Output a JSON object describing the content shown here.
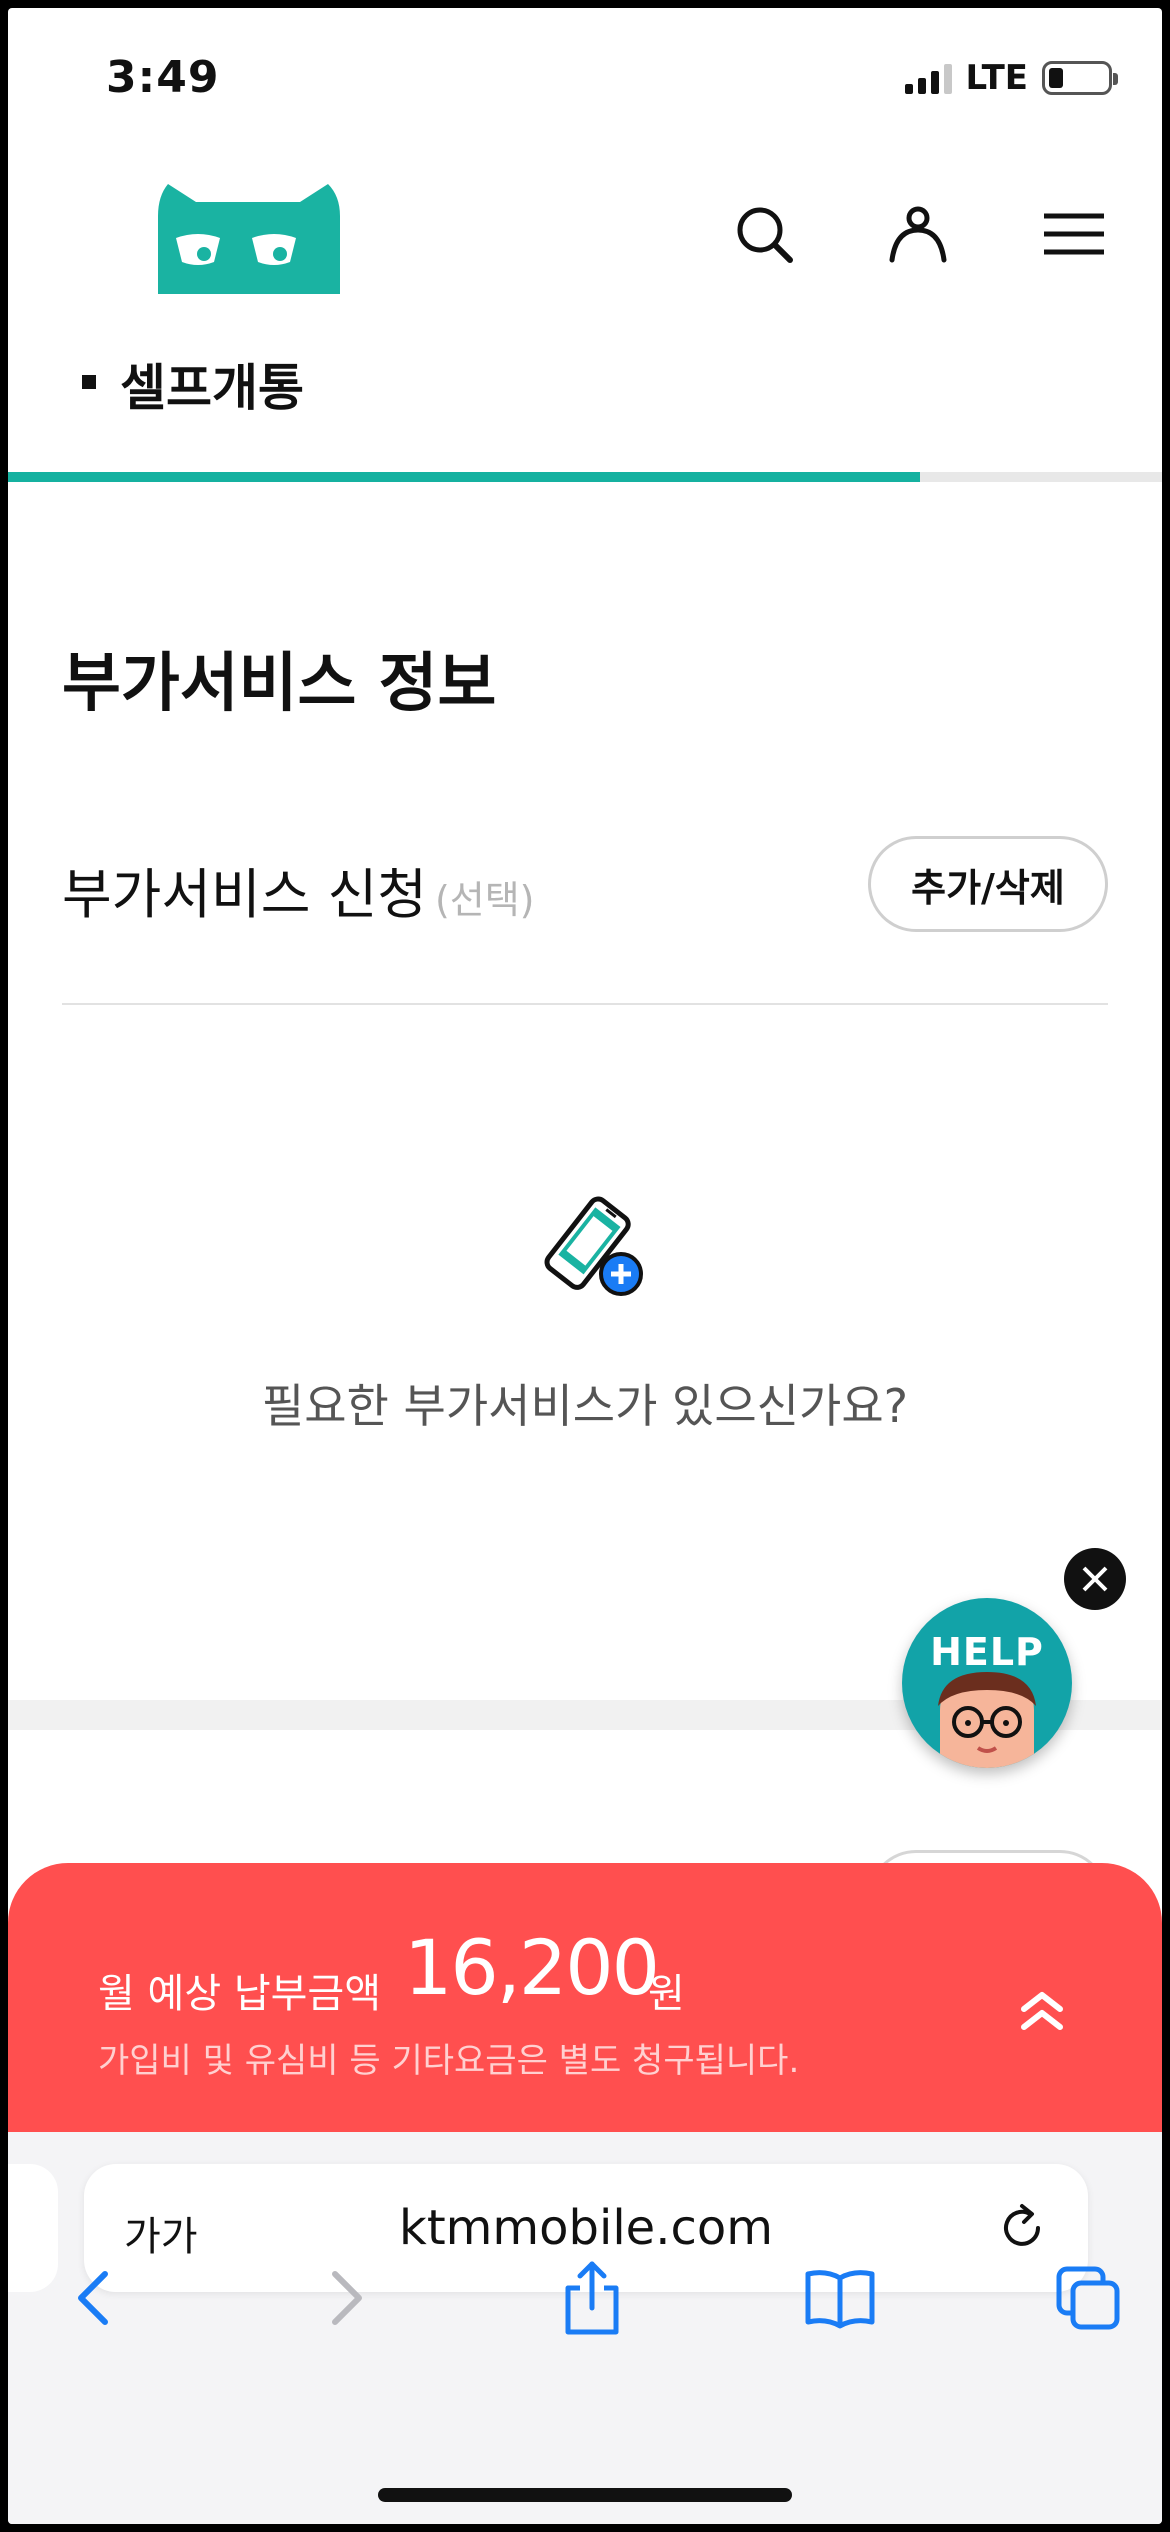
{
  "status_bar": {
    "time": "3:49",
    "network": "LTE",
    "battery_percent": 15
  },
  "header": {
    "logo": "cat-logo-icon",
    "icons": [
      "search-icon",
      "user-icon",
      "menu-icon"
    ],
    "section_title": "셀프개통",
    "progress_fraction": 0.79,
    "progress_color": "#15b1a0"
  },
  "main": {
    "heading": "부가서비스 정보",
    "addon_row": {
      "label": "부가서비스 신청",
      "optional": "(선택)",
      "button": "추가/삭제"
    },
    "empty_state": {
      "icon": "phone-add-icon",
      "text": "필요한 부가서비스가 있으신가요?"
    }
  },
  "help_widget": {
    "label": "HELP",
    "close_icon": "close-icon"
  },
  "fee_panel": {
    "label": "월 예상 납부금액",
    "amount": "16,200",
    "unit": "원",
    "note": "가입비 및 유심비 등 기타요금은 별도 청구됩니다.",
    "toggle_icon": "double-chevron-up-icon",
    "color": "#ff4f4f"
  },
  "browser": {
    "aa_label": "가가",
    "url": "ktmmobile.com",
    "reload_icon": "reload-icon",
    "toolbar_icons": [
      "back-icon",
      "forward-icon",
      "share-icon",
      "bookmarks-icon",
      "tabs-icon"
    ],
    "accent": "#1a7cf5"
  }
}
